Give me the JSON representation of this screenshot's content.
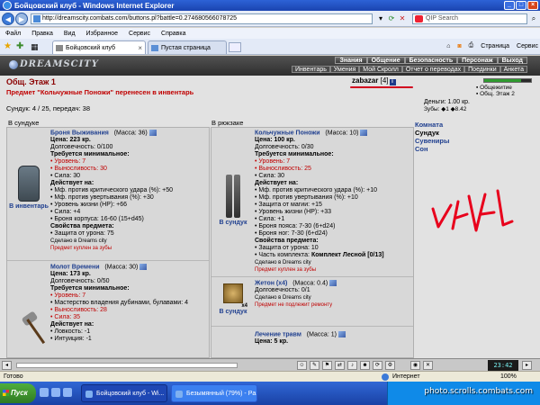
{
  "window": {
    "title": "Бойцовский клуб - Windows Internet Explorer"
  },
  "address": {
    "url": "http://dreamscity.combats.com/buttons.pl?battle=0.274680566078725"
  },
  "search": {
    "placeholder": "QIP Search"
  },
  "menu": [
    "Файл",
    "Правка",
    "Вид",
    "Избранное",
    "Сервис",
    "Справка"
  ],
  "tabs": [
    {
      "label": "Бойцовский клуб",
      "active": true
    },
    {
      "label": "Пустая страница",
      "active": false
    }
  ],
  "cmdbar": {
    "page_label": "Страница",
    "tools_label": "Сервис"
  },
  "game": {
    "logo": "DREAMSCITY",
    "topnav": [
      "Знания",
      "Общение",
      "Безопасность",
      "Персонаж",
      "Выход"
    ],
    "subnav": [
      "Инвентарь",
      "Умения",
      "Мой Скролл",
      "Отчет о переводах",
      "Поединки",
      "Анкета"
    ],
    "floor": "Общ. Этаж 1",
    "notice": "Предмет \"Кольчужные Поножи\" перенесен в инвентарь",
    "chest_status": "Сундук: 4 / 25, передач: 38",
    "user": {
      "name": "zabazar",
      "level": "[4]",
      "info": "i"
    },
    "rooms": [
      "Общежитие",
      "Общ. Этаж 2"
    ],
    "money": "Деньги: 1.00 кр.",
    "teeth": "Зубы: ◆1 ◆8.42",
    "hp_fraction": 0.78,
    "sidebar": [
      {
        "label": "Комната",
        "current": false
      },
      {
        "label": "Сундук",
        "current": true
      },
      {
        "label": "Сувениры",
        "current": false
      },
      {
        "label": "Сон",
        "current": false
      }
    ],
    "left_header": "В сундуке",
    "right_header": "В рюкзаке",
    "left_items": [
      {
        "name": "Броня Выживания",
        "mass": "(Масса: 36)",
        "price": "Цена: 223 кр.",
        "durability": "Долговечность: 0/100",
        "req_title": "Требуется минимальное:",
        "reqs": [
          {
            "text": "Уровень: 7",
            "red": true
          },
          {
            "text": "Выносливость: 30",
            "red": true
          },
          {
            "text": "Сила: 30",
            "red": false
          }
        ],
        "acts_title": "Действует на:",
        "acts": [
          "Мф. против критического удара (%): +50",
          "Мф. против увертывания (%): +30",
          "Уровень жизни (HP): +66",
          "Сила: +4",
          "Броня корпуса: 16-60 (15+d45)"
        ],
        "props_title": "Свойства предмета:",
        "props": [
          "Защита от урона: 75"
        ],
        "made": "Сделано в Dreams city",
        "bought": "Предмет куплен за зубы",
        "action": "В инвентарь"
      },
      {
        "name": "Молот Времени",
        "mass": "(Масса: 30)",
        "price": "Цена: 173 кр.",
        "durability": "Долговечность: 0/50",
        "req_title": "Требуется минимальное:",
        "reqs": [
          {
            "text": "Уровень: 7",
            "red": true
          },
          {
            "text": "Мастерство владения дубинами, булавами: 4",
            "red": false
          },
          {
            "text": "Выносливость: 28",
            "red": true
          },
          {
            "text": "Сила: 35",
            "red": true
          }
        ],
        "acts_title": "Действует на:",
        "acts": [
          "Ловкость: -1",
          "Интуиция: -1"
        ]
      }
    ],
    "right_items": [
      {
        "name": "Кольчужные Поножи",
        "mass": "(Масса: 10)",
        "price": "Цена: 100 кр.",
        "durability": "Долговечность: 0/30",
        "req_title": "Требуется минимальное:",
        "reqs": [
          {
            "text": "Уровень: 7",
            "red": true
          },
          {
            "text": "Выносливость: 25",
            "red": true
          },
          {
            "text": "Сила: 30",
            "red": false
          }
        ],
        "acts_title": "Действует на:",
        "acts": [
          "Мф. против критического удара (%): +10",
          "Мф. против увертывания (%): +10",
          "Защита от магии: +15",
          "Уровень жизни (HP): +33",
          "Сила: +1",
          "Броня пояса: 7-30 (6+d24)",
          "Броня ног: 7-30 (6+d24)"
        ],
        "props_title": "Свойства предмета:",
        "props": [
          "Защита от урона: 10"
        ],
        "set_label": "Часть комплекта:",
        "set_value": "Комплект Лесной [0/13]",
        "made": "Сделано в Dreams city",
        "bought": "Предмет куплен за зубы",
        "action": "В сундук"
      },
      {
        "name": "Жетон (x4)",
        "mass": "(Масса: 0.4)",
        "durability": "Долговечность: 0/1",
        "made": "Сделано в Dreams city",
        "bought": "Предмет не подлежит ремонту",
        "action": "В сундук",
        "count": "x4"
      },
      {
        "name": "Лечение травм",
        "mass": "(Масса: 1)",
        "price": "Цена: 5 кр."
      }
    ]
  },
  "clock": "23:42",
  "status": {
    "left": "Готово",
    "zone": "Интернет",
    "zoom": "100%"
  },
  "taskbar": {
    "start": "Пуск",
    "windows": [
      "Бойцовский клуб - Wi...",
      "Безымянный (79%) - Pa..."
    ],
    "watermark": "photo.scrolls.combats.com"
  },
  "colors": {
    "title": "#1a44b0",
    "accent_red": "#c00000",
    "link": "#1f3f8f",
    "graffiti": "#e8001c"
  }
}
